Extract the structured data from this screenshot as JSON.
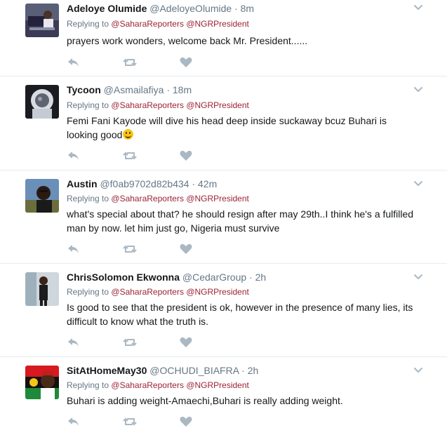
{
  "tweets": [
    {
      "name": "Adeloye Olumide",
      "handle": "@AdeloyeOlumide",
      "dot": "·",
      "time": "8m",
      "replying_prefix": "Replying to",
      "mention1": "@SaharaReporters",
      "mention2": "@NGRPresident",
      "text": "prayers work wonders, welcome back Mr. President......",
      "avatar": "avatar-adeloye"
    },
    {
      "name": "Tycoon",
      "handle": "@Asmailafiya",
      "dot": "·",
      "time": "18m",
      "replying_prefix": "Replying to",
      "mention1": "@SaharaReporters",
      "mention2": "@NGRPresident",
      "text": "Femi Fani Kayode will dive his head deep inside suckaway bcuz Buhari is looking good",
      "emoji": "smiley-emoji",
      "avatar": "avatar-tycoon"
    },
    {
      "name": "Austin",
      "handle": "@f0ab9702d82b434",
      "dot": "·",
      "time": "42m",
      "replying_prefix": "Replying to",
      "mention1": "@SaharaReporters",
      "mention2": "@NGRPresident",
      "text": "what's special about that? he should resign after may 29th..I think he's a fulfilled man by now. let him just go, Nigeria must survive",
      "avatar": "avatar-austin"
    },
    {
      "name": "ChrisSolomon Ekwonna",
      "handle": "@CedarGroup",
      "dot": "·",
      "time": "2h",
      "replying_prefix": "Replying to",
      "mention1": "@SaharaReporters",
      "mention2": "@NGRPresident",
      "text": "Is good to see that the president is ok, however in the presence of many lies, its difficult to know what the truth is.",
      "avatar": "avatar-chris"
    },
    {
      "name": "SitAtHomeMay30",
      "handle": "@OCHUDI_BIAFRA",
      "dot": "·",
      "time": "2h",
      "replying_prefix": "Replying to",
      "mention1": "@SaharaReporters",
      "mention2": "@NGRPresident",
      "text": "Buhari is adding weight-Amaechi,Buhari is really adding weight.",
      "avatar": "avatar-sitathome"
    }
  ],
  "icons": {
    "reply": "reply-icon",
    "retweet": "retweet-icon",
    "like": "heart-icon",
    "more": "chevron-down-icon"
  },
  "colors": {
    "name": "#14171a",
    "meta": "#657786",
    "mention": "#9b2335",
    "action_icon": "#aab8c2",
    "divider": "#e6ecf0"
  }
}
